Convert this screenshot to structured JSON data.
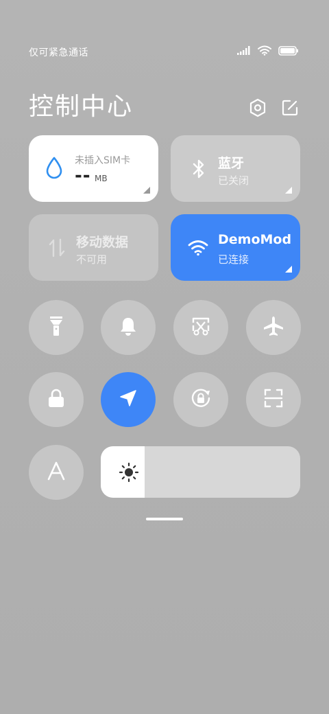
{
  "status_bar": {
    "carrier_text": "仅可紧急通话",
    "battery_level": 1.0
  },
  "header": {
    "title": "控制中心"
  },
  "tiles": {
    "data_usage": {
      "label": "未插入SIM卡",
      "value": "--",
      "unit": "MB"
    },
    "bluetooth": {
      "title": "蓝牙",
      "status": "已关闭"
    },
    "mobile_data": {
      "title": "移动数据",
      "status": "不可用"
    },
    "wifi": {
      "title": "DemoMode",
      "status": "已连接"
    }
  },
  "toggles": [
    {
      "icon": "flashlight-icon",
      "active": false
    },
    {
      "icon": "bell-icon",
      "active": false
    },
    {
      "icon": "screenshot-icon",
      "active": false
    },
    {
      "icon": "airplane-icon",
      "active": false
    },
    {
      "icon": "lock-icon",
      "active": false
    },
    {
      "icon": "location-icon",
      "active": true
    },
    {
      "icon": "rotation-lock-icon",
      "active": false
    },
    {
      "icon": "scanner-icon",
      "active": false
    },
    {
      "icon": "font-icon",
      "active": false
    }
  ],
  "brightness": {
    "level": 0.22,
    "icon": "sun-icon"
  },
  "colors": {
    "accent": "#3e86f7",
    "tile_inactive": "#cbcbcb",
    "circle_inactive": "#c6c6c6",
    "droplet": "#2f8ff0"
  }
}
